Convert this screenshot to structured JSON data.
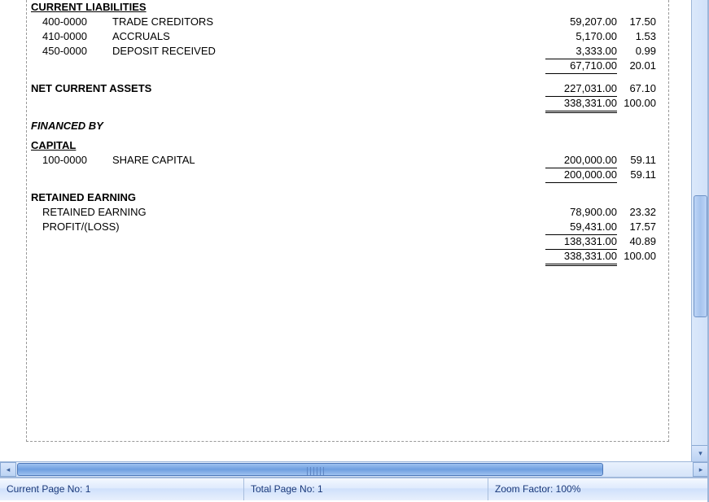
{
  "sections": {
    "current_liabilities": {
      "title": "CURRENT LIABILITIES",
      "rows": [
        {
          "code": "400-0000",
          "desc": "TRADE CREDITORS",
          "amt": "59,207.00",
          "pct": "17.50"
        },
        {
          "code": "410-0000",
          "desc": "ACCRUALS",
          "amt": "5,170.00",
          "pct": "1.53"
        },
        {
          "code": "450-0000",
          "desc": "DEPOSIT RECEIVED",
          "amt": "3,333.00",
          "pct": "0.99"
        }
      ],
      "subtotal": {
        "amt": "67,710.00",
        "pct": "20.01"
      }
    },
    "net_current_assets": {
      "title": "NET CURRENT ASSETS",
      "value": {
        "amt": "227,031.00",
        "pct": "67.10"
      },
      "total": {
        "amt": "338,331.00",
        "pct": "100.00"
      }
    },
    "financed_by": {
      "title": "FINANCED BY"
    },
    "capital": {
      "title": "CAPITAL",
      "rows": [
        {
          "code": "100-0000",
          "desc": "SHARE CAPITAL",
          "amt": "200,000.00",
          "pct": "59.11"
        }
      ],
      "subtotal": {
        "amt": "200,000.00",
        "pct": "59.11"
      }
    },
    "retained_earning": {
      "title": "RETAINED EARNING",
      "rows": [
        {
          "desc": "RETAINED EARNING",
          "amt": "78,900.00",
          "pct": "23.32"
        },
        {
          "desc": "PROFIT/(LOSS)",
          "amt": "59,431.00",
          "pct": "17.57"
        }
      ],
      "subtotal": {
        "amt": "138,331.00",
        "pct": "40.89"
      },
      "grandtotal": {
        "amt": "338,331.00",
        "pct": "100.00"
      }
    }
  },
  "status": {
    "current_page": "Current Page No: 1",
    "total_page": "Total Page No: 1",
    "zoom": "Zoom Factor: 100%"
  }
}
